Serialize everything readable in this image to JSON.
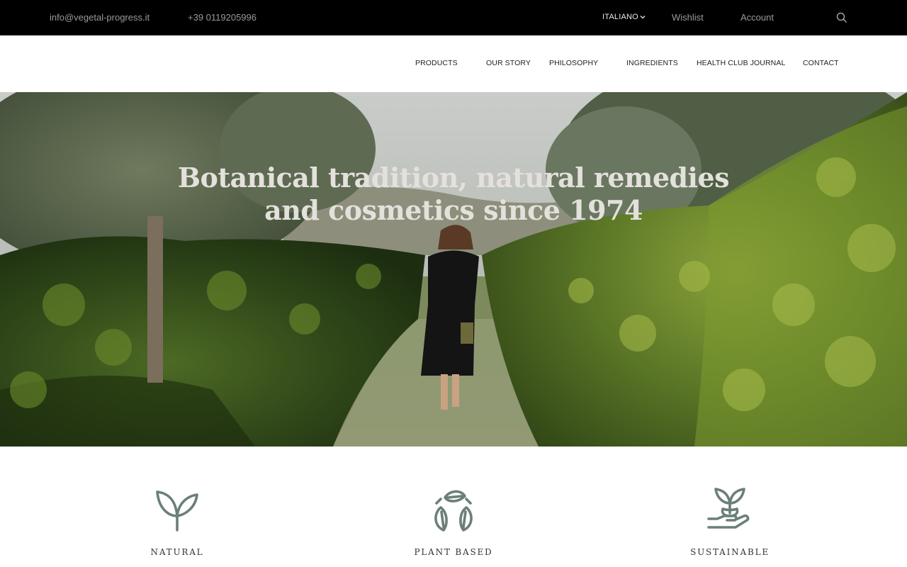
{
  "topbar": {
    "email": "info@vegetal-progress.it",
    "phone": "+39 0119205996",
    "language": "ITALIANO",
    "wishlist": "Wishlist",
    "account": "Account",
    "search_icon": "search-icon"
  },
  "nav": {
    "items": [
      {
        "label": "PRODUCTS"
      },
      {
        "label": "OUR STORY"
      },
      {
        "label": "PHILOSOPHY"
      },
      {
        "label": "INGREDIENTS"
      },
      {
        "label": "HEALTH CLUB JOURNAL"
      },
      {
        "label": "CONTACT"
      }
    ]
  },
  "hero": {
    "title_line1": "Botanical tradition, natural remedies",
    "title_line2": "and cosmetics since 1974"
  },
  "features": [
    {
      "label": "NATURAL",
      "icon": "sprout-icon"
    },
    {
      "label": "PLANT BASED",
      "icon": "leaf-recycle-icon"
    },
    {
      "label": "SUSTAINABLE",
      "icon": "hand-plant-icon"
    }
  ],
  "colors": {
    "topbar_bg": "#000000",
    "icon_green": "#6b7f78",
    "hero_title": "#e4e1dc"
  }
}
